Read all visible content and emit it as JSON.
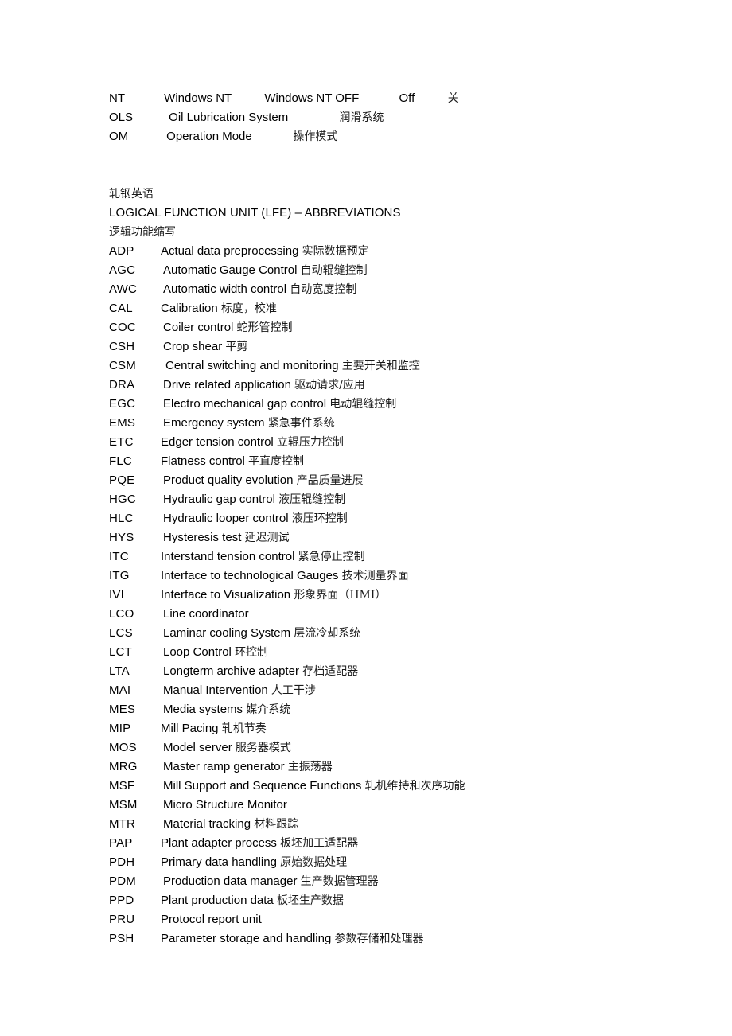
{
  "document": {
    "top_rows": [
      {
        "key": "NT",
        "english": "Windows NT",
        "state": "Windows NT OFF",
        "off": "Off",
        "chinese": "关"
      },
      {
        "key": "OLS",
        "english": "Oil Lubrication System",
        "chinese": "润滑系统"
      },
      {
        "key": "OM",
        "english": "Operation Mode",
        "chinese": "操作模式"
      }
    ],
    "heading": {
      "subject_cn": "轧钢英语",
      "title_en": "LOGICAL FUNCTION UNIT (LFE) – ABBREVIATIONS",
      "title_cn": "逻辑功能缩写"
    },
    "abbreviations": [
      {
        "key": "ADP",
        "english": "Actual data preprocessing ",
        "chinese": "实际数据预定",
        "indent": 0
      },
      {
        "key": "AGC",
        "english": "Automatic Gauge Control ",
        "chinese": "自动辊缝控制",
        "indent": 1
      },
      {
        "key": "AWC",
        "english": " Automatic width control ",
        "chinese": "自动宽度控制",
        "indent": 1
      },
      {
        "key": "CAL",
        "english": "Calibration ",
        "chinese": "标度，校准",
        "indent": 0
      },
      {
        "key": "COC",
        "english": " Coiler control ",
        "chinese": "蛇形管控制",
        "indent": 1
      },
      {
        "key": "CSH",
        "english": "Crop shear  ",
        "chinese": "平剪",
        "indent": 1
      },
      {
        "key": "CSM",
        "english": "Central switching and monitoring ",
        "chinese": "主要开关和监控",
        "indent": 2
      },
      {
        "key": "DRA",
        "english": "Drive related application ",
        "chinese": "驱动请求/应用",
        "indent": 1
      },
      {
        "key": "EGC",
        "english": "Electro mechanical gap control ",
        "chinese": "电动辊缝控制",
        "indent": 1
      },
      {
        "key": "EMS",
        "english": " Emergency system ",
        "chinese": "紧急事件系统",
        "indent": 1
      },
      {
        "key": "ETC",
        "english": "Edger tension control ",
        "chinese": "立辊压力控制",
        "indent": 0
      },
      {
        "key": "FLC",
        "english": "Flatness control ",
        "chinese": "平直度控制",
        "indent": 0
      },
      {
        "key": "PQE",
        "english": "Product quality evolution ",
        "chinese": "产品质量进展",
        "indent": 1
      },
      {
        "key": "HGC",
        "english": " Hydraulic gap control ",
        "chinese": "液压辊缝控制",
        "indent": 1
      },
      {
        "key": "HLC",
        "english": "Hydraulic looper control ",
        "chinese": "液压环控制",
        "indent": 1
      },
      {
        "key": "HYS",
        "english": " Hysteresis test  ",
        "chinese": "延迟测试",
        "indent": 1
      },
      {
        "key": "ITC",
        "english": "Interstand tension control ",
        "chinese": "紧急停止控制",
        "indent": 0
      },
      {
        "key": "ITG",
        "english": "Interface to technological Gauges ",
        "chinese": "技术测量界面",
        "indent": 0
      },
      {
        "key": "IVI",
        "english": "Interface to Visualization ",
        "chinese": "形象界面（HMI）",
        "indent": 0
      },
      {
        "key": "LCO",
        "english": " Line coordinator",
        "chinese": "",
        "indent": 1
      },
      {
        "key": "LCS",
        "english": "Laminar cooling System ",
        "chinese": "层流冷却系统",
        "indent": 1
      },
      {
        "key": "LCT",
        "english": "Loop Control ",
        "chinese": "环控制",
        "indent": 1
      },
      {
        "key": "LTA",
        "english": "Longterm archive adapter ",
        "chinese": "存档适配器",
        "indent": 1
      },
      {
        "key": "MAI",
        "english": "Manual Intervention  ",
        "chinese": "人工干涉",
        "indent": 1
      },
      {
        "key": "MES",
        "english": " Media systems  ",
        "chinese": "媒介系统",
        "indent": 1
      },
      {
        "key": "MIP",
        "english": "Mill Pacing  ",
        "chinese": "轧机节奏",
        "indent": 0
      },
      {
        "key": "MOS",
        "english": " Model server  ",
        "chinese": "服务器模式",
        "indent": 1
      },
      {
        "key": "MRG",
        "english": " Master ramp generator ",
        "chinese": "主振荡器",
        "indent": 1
      },
      {
        "key": "MSF",
        "english": "Mill Support and Sequence Functions ",
        "chinese": "轧机维持和次序功能",
        "indent": 1
      },
      {
        "key": "MSM",
        "english": " Micro Structure Monitor",
        "chinese": "",
        "indent": 1
      },
      {
        "key": "MTR",
        "english": "Material tracking  ",
        "chinese": "材料跟踪",
        "indent": 1
      },
      {
        "key": "PAP",
        "english": "Plant adapter process ",
        "chinese": "板坯加工适配器",
        "indent": 0
      },
      {
        "key": "PDH",
        "english": " Primary data handling ",
        "chinese": "原始数据处理",
        "indent": 0
      },
      {
        "key": "PDM",
        "english": " Production data manager ",
        "chinese": "生产数据管理器",
        "indent": 1
      },
      {
        "key": "PPD",
        "english": "Plant production data ",
        "chinese": "板坯生产数据",
        "indent": 0
      },
      {
        "key": "PRU",
        "english": "Protocol report unit",
        "chinese": "",
        "indent": 0
      },
      {
        "key": "PSH",
        "english": "Parameter storage and handling ",
        "chinese": "参数存储和处理器",
        "indent": 0
      }
    ]
  }
}
